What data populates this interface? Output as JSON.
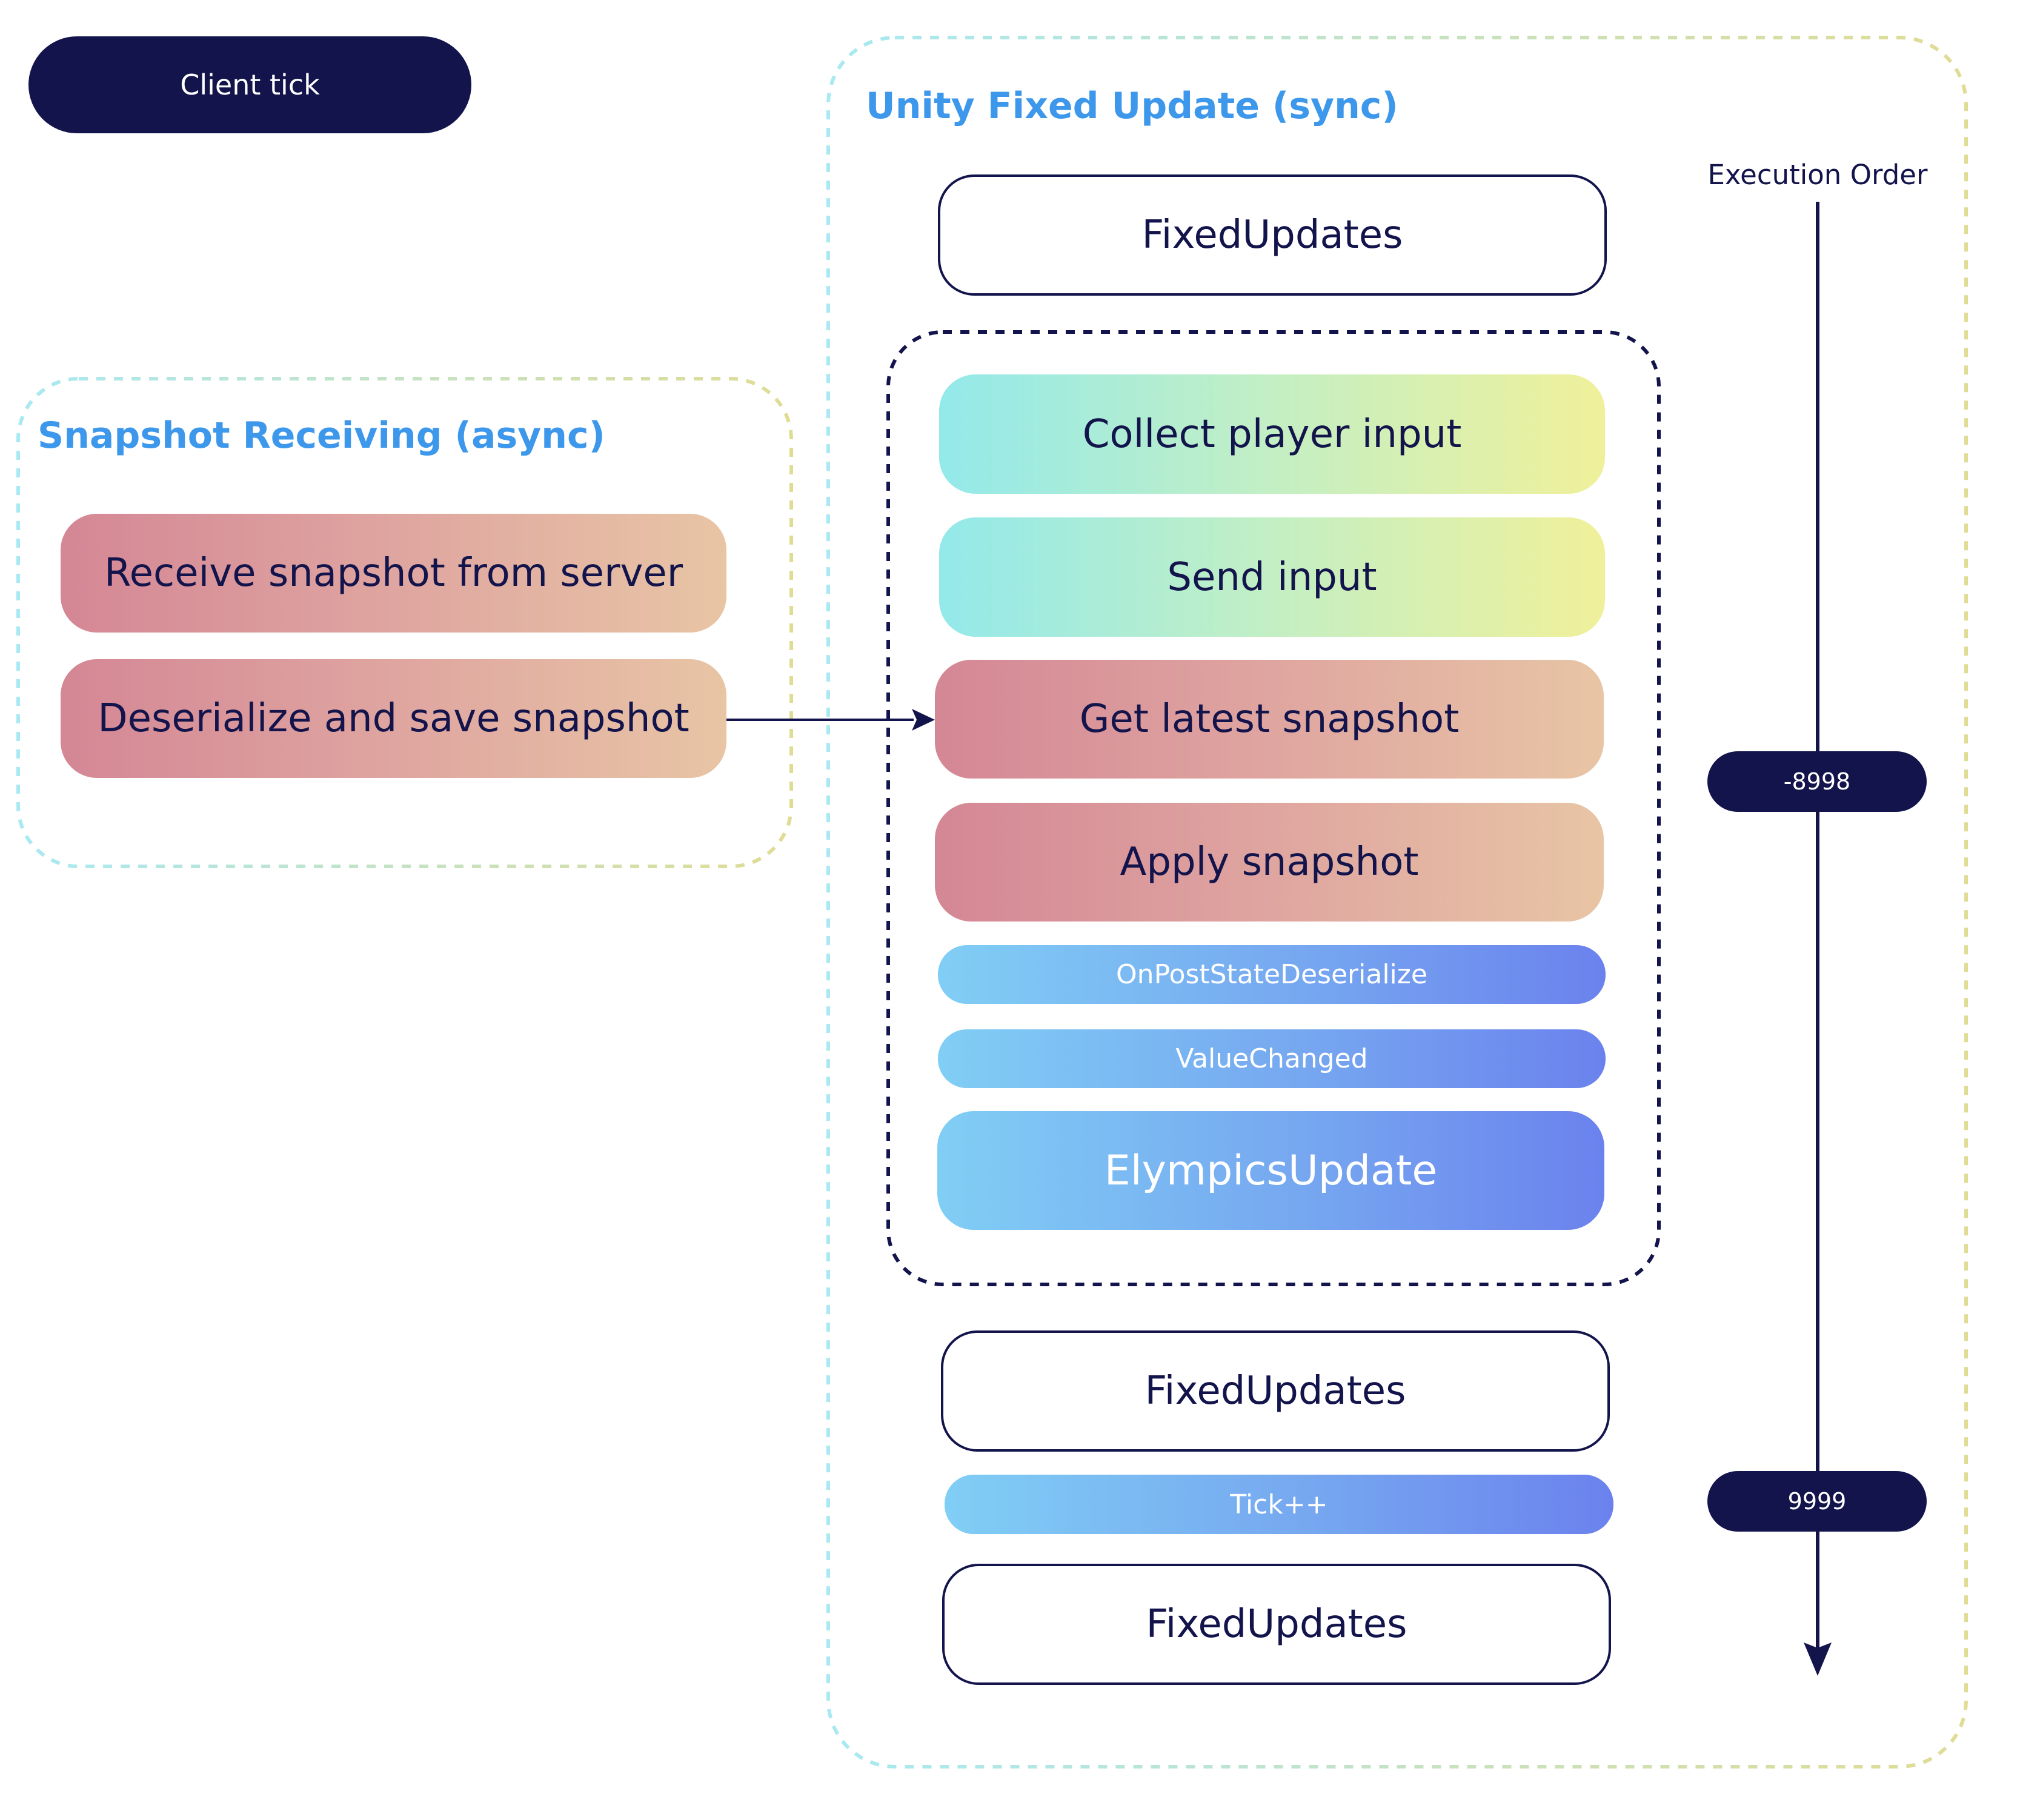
{
  "client_tick": {
    "label": "Client tick"
  },
  "snapshot_receiving": {
    "title": "Snapshot Receiving (async)",
    "steps": [
      {
        "label": "Receive snapshot from server",
        "style": "pink"
      },
      {
        "label": "Deserialize and save snapshot",
        "style": "pink"
      }
    ]
  },
  "unity_fixed_update": {
    "title": "Unity Fixed Update (sync)",
    "execution_order_label": "Execution Order",
    "steps_before": [
      {
        "label": "FixedUpdates",
        "style": "outline"
      }
    ],
    "elympics_group": [
      {
        "label": "Collect player input",
        "style": "teal"
      },
      {
        "label": "Send input",
        "style": "teal"
      },
      {
        "label": "Get latest snapshot",
        "style": "pink"
      },
      {
        "label": "Apply snapshot",
        "style": "pink"
      },
      {
        "label": "OnPostStateDeserialize",
        "style": "blue-small"
      },
      {
        "label": "ValueChanged",
        "style": "blue-small"
      },
      {
        "label": "ElympicsUpdate",
        "style": "blue-large"
      }
    ],
    "steps_after": [
      {
        "label": "FixedUpdates",
        "style": "outline"
      },
      {
        "label": "Tick++",
        "style": "blue-small"
      },
      {
        "label": "FixedUpdates",
        "style": "outline"
      }
    ],
    "execution_order_markers": [
      {
        "value": "-8998"
      },
      {
        "value": "9999"
      }
    ]
  },
  "connections": [
    {
      "from": "Deserialize and save snapshot",
      "to": "Get latest snapshot"
    }
  ],
  "colors": {
    "navy": "#13144B",
    "title_blue": "#3D98EC",
    "teal_start": "#93E9EA",
    "teal_end": "#F0F09A",
    "pink_start": "#D48795",
    "pink_end": "#E8C5A5",
    "blue_start": "#80CEF5",
    "blue_end": "#6B82EE",
    "group_border_start": "#A8E9F3",
    "group_border_end": "#E0DC94"
  }
}
